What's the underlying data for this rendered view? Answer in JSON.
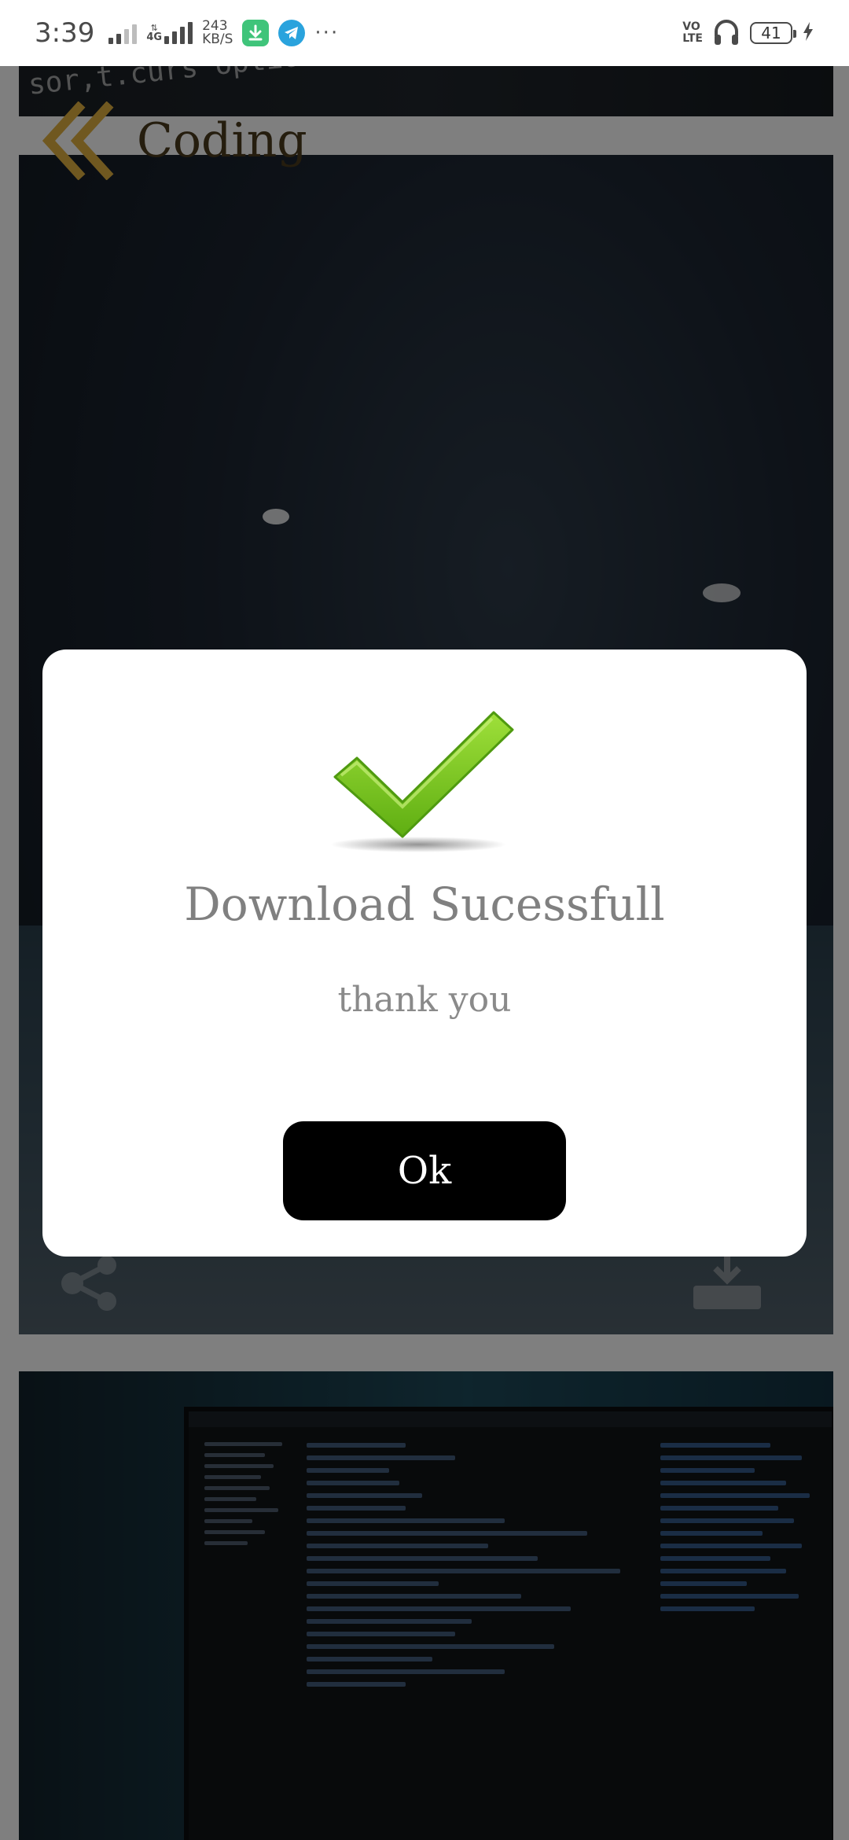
{
  "status_bar": {
    "time": "3:39",
    "network_type": "4G",
    "speed_value": "243",
    "speed_unit": "KB/S",
    "volte_line1": "VO",
    "volte_line2": "LTE",
    "battery_level": "41",
    "icons": [
      "signal-icon",
      "data-arrows-icon",
      "download-app-icon",
      "telegram-icon",
      "more-dots-icon",
      "headphones-icon",
      "battery-icon",
      "charging-icon"
    ]
  },
  "header": {
    "title": "Coding",
    "back_icon": "double-chevron-left-icon",
    "accent_color": "#e0b040"
  },
  "background_strip_code": {
    "line": "sor,t.curs  options.ty  Out.t.fadeOu  ing\"==type  strings  ()))t.strPos"
  },
  "cards": [
    {
      "name": "office-photo",
      "actions": [
        "share-icon",
        "download-icon"
      ]
    },
    {
      "name": "xcode-screen-photo"
    }
  ],
  "dialog": {
    "icon": "checkmark-icon",
    "title": "Download Sucessfull",
    "message": "thank you",
    "ok_label": "Ok",
    "check_color": "#7cc520"
  }
}
